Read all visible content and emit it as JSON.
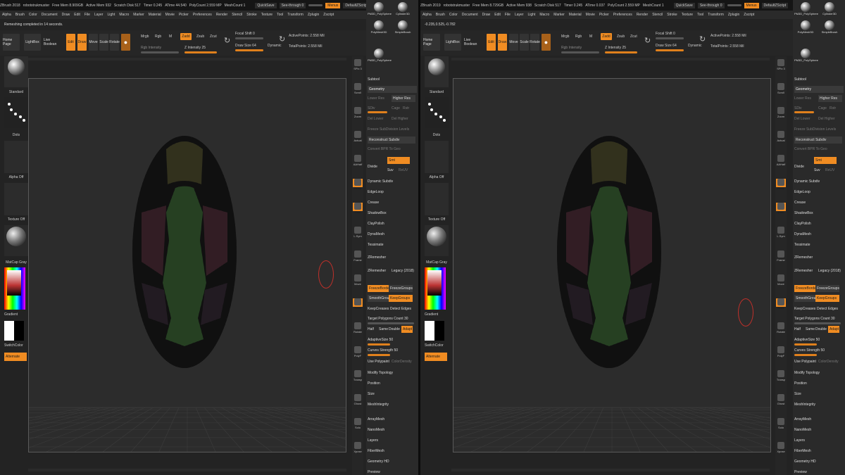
{
  "left": {
    "title_items": [
      "ZBrush 2018",
      "robotstrukmuster",
      "Free Mem 8.909GB",
      "Active Mem 932",
      "Scratch Disk 517",
      "Timer 0.245",
      "ATime 44.540",
      "PolyCount 2.559 MP",
      "MeshCount 1"
    ],
    "quicksave": "QuickSave",
    "seethrough": "See-through 0",
    "menus_btn": "Menus",
    "script_btn": "DefaultZScript",
    "menu_items": [
      "Alpha",
      "Brush",
      "Color",
      "Document",
      "Draw",
      "Edit",
      "File",
      "Layer",
      "Light",
      "Macro",
      "Marker",
      "Material",
      "Movie",
      "Picker",
      "Preferences",
      "Render",
      "Stencil",
      "Stroke",
      "Texture",
      "Tool",
      "Transform",
      "Zplugin",
      "Zscript"
    ],
    "status": "Remeshing completed in 14 seconds.",
    "toolbar": {
      "home": "Home Page",
      "lightbox": "LightBox",
      "boolean": "Live Boolean",
      "edit": "Edit",
      "draw": "Draw",
      "move": "Move",
      "scale": "Scale",
      "rotate": "Rotate",
      "mrgb": "Mrgb",
      "rgb": "Rgb",
      "m": "M",
      "zadd": "Zadd",
      "zsub": "Zsub",
      "zcut": "Zcut",
      "rgb_intensity": "Rgb Intensity",
      "z_intensity": "Z Intensity 25",
      "focal": "Focal Shift 0",
      "drawsize": "Draw Size 64",
      "dynamic": "Dynamic",
      "active_points": "ActivePoints: 2.558 Mil",
      "total_points": "TotalPoints: 2.558 Mil"
    },
    "shelf": [
      "Standard",
      "Dots",
      "Alpha Off",
      "Texture Off",
      "MatCap Gray",
      "Gradient",
      "SwitchColor",
      "Alternate"
    ],
    "rightshelf": [
      "SPix 3",
      "Scroll",
      "Zoom",
      "Actual",
      "AAHalf",
      "Persp",
      "Floor",
      "L.Sym",
      "Frame",
      "Move",
      "Scale",
      "Rotate",
      "PolyF",
      "Transp",
      "Ghost",
      "Solo",
      "Xpose"
    ],
    "palette": {
      "subtool": "Subtool",
      "geometry": "Geometry",
      "lower_res": "Lower Res",
      "higher_res": "Higher Res",
      "sdiv": "SDiv",
      "cage": "Cage",
      "rstr": "Rstr",
      "del_lower": "Del Lower",
      "del_higher": "Del Higher",
      "freeze": "Freeze SubDivision Levels",
      "reconstruct": "Reconstruct Subdiv",
      "convert": "Convert BPR To Geo",
      "divide": "Divide",
      "smt": "Smt",
      "suv": "Suv",
      "reuv": "ReUV",
      "items": [
        "Dynamic Subdiv",
        "EdgeLoop",
        "Crease",
        "ShadowBox",
        "ClayPolish",
        "DynaMesh",
        "Tessimate"
      ],
      "zremesher": "ZRemesher",
      "zremesher_btn": "ZRemesher",
      "legacy": "Legacy (2018)",
      "freezeborder": "FreezeBorder",
      "freezegroups": "FreezeGroups",
      "smoothgroups": "SmoothGroups",
      "keepgroups": "KeepGroups",
      "keepcreases": "KeepCreases",
      "detectedges": "Detect Edges",
      "target": "Target Polygons Count 30",
      "half": "Half",
      "same": "Same",
      "double": "Double",
      "adapt": "Adapt",
      "adaptivesize": "AdaptiveSize 50",
      "curves": "Curves Strength 50",
      "usepoly": "Use Polypaint",
      "colordensity": "ColorDensity",
      "after": [
        "Modify Topology",
        "Position",
        "Size",
        "MeshIntegrity"
      ],
      "after2": [
        "ArrayMesh",
        "NanoMesh",
        "Layers",
        "FiberMesh",
        "Geometry HD",
        "Preview"
      ]
    },
    "tool_thumbs": [
      "PM3D_PolySphere",
      "Cylinder3D",
      "PolyMesh3D",
      "SimpleBrush",
      "PM3D_PolySphere"
    ]
  },
  "right": {
    "title_items": [
      "ZBrush 2019",
      "robotstrukmuster",
      "Free Mem 8.729GB",
      "Active Mem 938",
      "Scratch Disk 517",
      "Timer 0.245",
      "ATime 0.037",
      "PolyCount 2.559 MP",
      "MeshCount 1"
    ],
    "quicksave": "QuickSave",
    "seethrough": "See-through 0",
    "menus_btn": "Menus",
    "script_btn": "DefaultZScript",
    "menu_items": [
      "Alpha",
      "Brush",
      "Color",
      "Document",
      "Draw",
      "Edit",
      "File",
      "Layer",
      "Light",
      "Macro",
      "Marker",
      "Material",
      "Movie",
      "Picker",
      "Preferences",
      "Render",
      "Stencil",
      "Stroke",
      "Texture",
      "Tool",
      "Transform",
      "Zplugin",
      "Zscript"
    ],
    "status": "-0.235,0.525,-0.782",
    "toolbar": {
      "home": "Home Page",
      "lightbox": "LightBox",
      "boolean": "Live Boolean",
      "edit": "Edit",
      "draw": "Draw",
      "move": "Move",
      "scale": "Scale",
      "rotate": "Rotate",
      "mrgb": "Mrgb",
      "rgb": "Rgb",
      "m": "M",
      "zadd": "Zadd",
      "zsub": "Zsub",
      "zcut": "Zcut",
      "rgb_intensity": "Rgb Intensity",
      "z_intensity": "Z Intensity 25",
      "focal": "Focal Shift 0",
      "drawsize": "Draw Size 64",
      "dynamic": "Dynamic",
      "active_points": "ActivePoints: 2.558 Mil",
      "total_points": "TotalPoints: 2.558 Mil"
    },
    "shelf": [
      "Standard",
      "Dots",
      "Alpha Off",
      "Texture Off",
      "MatCap Gray",
      "Gradient",
      "SwitchColor",
      "Alternate"
    ],
    "rightshelf": [
      "SPix 3",
      "Scroll",
      "Zoom",
      "Actual",
      "AAHalf",
      "Persp",
      "Floor",
      "L.Sym",
      "Frame",
      "Move",
      "Scale",
      "Rotate",
      "PolyF",
      "Transp",
      "Ghost",
      "Solo",
      "Xpose"
    ],
    "palette": {
      "subtool": "Subtool",
      "geometry": "Geometry",
      "lower_res": "Lower Res",
      "higher_res": "Higher Res",
      "sdiv": "SDiv",
      "cage": "Cage",
      "rstr": "Rstr",
      "del_lower": "Del Lower",
      "del_higher": "Del Higher",
      "freeze": "Freeze SubDivision Levels",
      "reconstruct": "Reconstruct Subdiv",
      "convert": "Convert BPR To Geo",
      "divide": "Divide",
      "smt": "Smt",
      "suv": "Suv",
      "reuv": "ReUV",
      "items": [
        "Dynamic Subdiv",
        "EdgeLoop",
        "Crease",
        "ShadowBox",
        "ClayPolish",
        "DynaMesh",
        "Tessimate"
      ],
      "zremesher": "ZRemesher",
      "zremesher_btn": "ZRemesher",
      "legacy": "Legacy (2018)",
      "freezeborder": "FreezeBorder",
      "freezegroups": "FreezeGroups",
      "smoothgroups": "SmoothGroups",
      "keepgroups": "KeepGroups",
      "keepcreases": "KeepCreases",
      "detectedges": "Detect Edges",
      "target": "Target Polygons Count 30",
      "half": "Half",
      "same": "Same",
      "double": "Double",
      "adapt": "Adapt",
      "adaptivesize": "AdaptiveSize 50",
      "curves": "Curves Strength 50",
      "usepoly": "Use Polypaint",
      "colordensity": "ColorDensity",
      "after": [
        "Modify Topology",
        "Position",
        "Size",
        "MeshIntegrity"
      ],
      "after2": [
        "ArrayMesh",
        "NanoMesh",
        "Layers",
        "FiberMesh",
        "Geometry HD",
        "Preview"
      ]
    },
    "tool_thumbs": [
      "PM3D_PolySphere",
      "Cylinder3D",
      "PolyMesh3D",
      "SimpleBrush",
      "PM3D_PolySphere"
    ]
  },
  "colors": {
    "accent": "#f08c22",
    "bg": "#232323",
    "canvas": "#2c2c2c"
  }
}
